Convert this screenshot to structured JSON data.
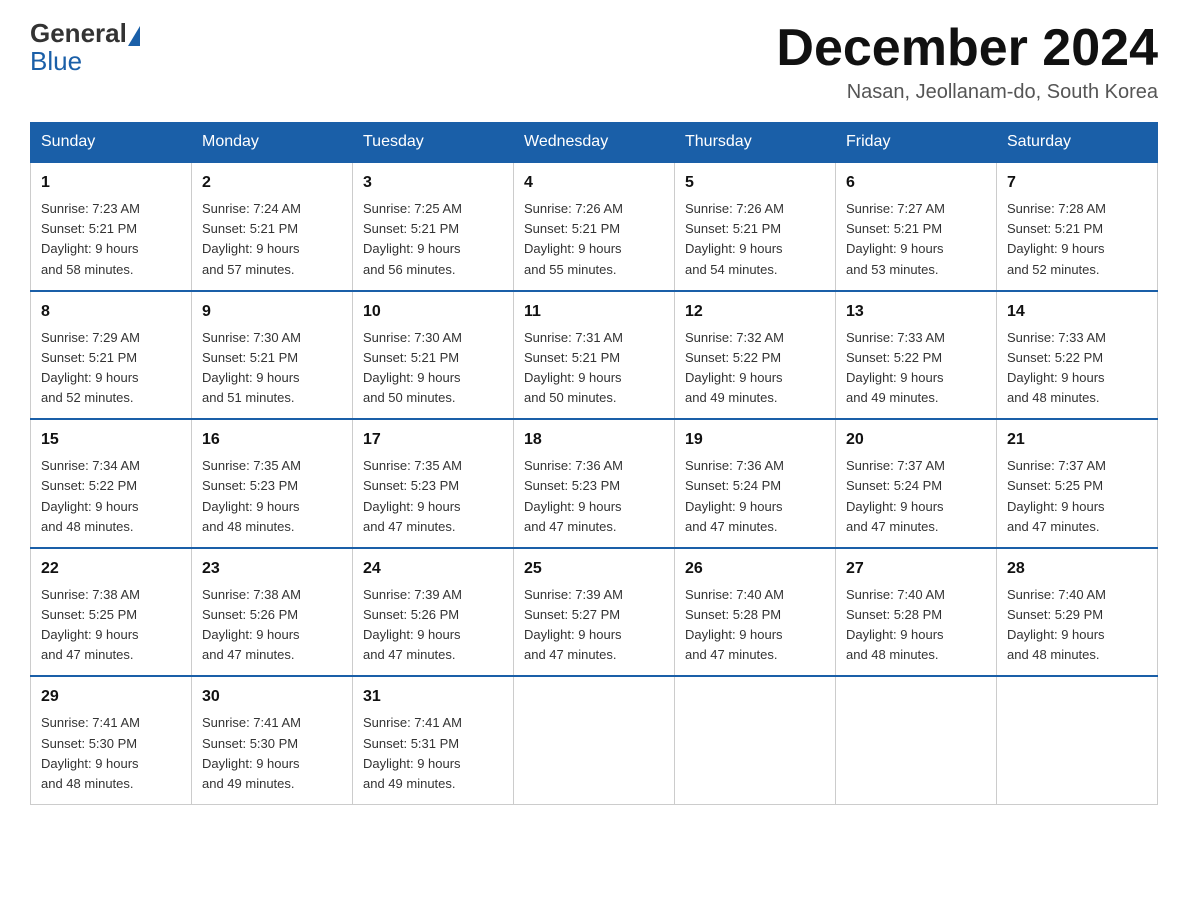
{
  "logo": {
    "text_general": "General",
    "text_blue": "Blue"
  },
  "header": {
    "title": "December 2024",
    "subtitle": "Nasan, Jeollanam-do, South Korea"
  },
  "days_of_week": [
    "Sunday",
    "Monday",
    "Tuesday",
    "Wednesday",
    "Thursday",
    "Friday",
    "Saturday"
  ],
  "weeks": [
    [
      {
        "day": "1",
        "sunrise": "7:23 AM",
        "sunset": "5:21 PM",
        "daylight": "9 hours and 58 minutes."
      },
      {
        "day": "2",
        "sunrise": "7:24 AM",
        "sunset": "5:21 PM",
        "daylight": "9 hours and 57 minutes."
      },
      {
        "day": "3",
        "sunrise": "7:25 AM",
        "sunset": "5:21 PM",
        "daylight": "9 hours and 56 minutes."
      },
      {
        "day": "4",
        "sunrise": "7:26 AM",
        "sunset": "5:21 PM",
        "daylight": "9 hours and 55 minutes."
      },
      {
        "day": "5",
        "sunrise": "7:26 AM",
        "sunset": "5:21 PM",
        "daylight": "9 hours and 54 minutes."
      },
      {
        "day": "6",
        "sunrise": "7:27 AM",
        "sunset": "5:21 PM",
        "daylight": "9 hours and 53 minutes."
      },
      {
        "day": "7",
        "sunrise": "7:28 AM",
        "sunset": "5:21 PM",
        "daylight": "9 hours and 52 minutes."
      }
    ],
    [
      {
        "day": "8",
        "sunrise": "7:29 AM",
        "sunset": "5:21 PM",
        "daylight": "9 hours and 52 minutes."
      },
      {
        "day": "9",
        "sunrise": "7:30 AM",
        "sunset": "5:21 PM",
        "daylight": "9 hours and 51 minutes."
      },
      {
        "day": "10",
        "sunrise": "7:30 AM",
        "sunset": "5:21 PM",
        "daylight": "9 hours and 50 minutes."
      },
      {
        "day": "11",
        "sunrise": "7:31 AM",
        "sunset": "5:21 PM",
        "daylight": "9 hours and 50 minutes."
      },
      {
        "day": "12",
        "sunrise": "7:32 AM",
        "sunset": "5:22 PM",
        "daylight": "9 hours and 49 minutes."
      },
      {
        "day": "13",
        "sunrise": "7:33 AM",
        "sunset": "5:22 PM",
        "daylight": "9 hours and 49 minutes."
      },
      {
        "day": "14",
        "sunrise": "7:33 AM",
        "sunset": "5:22 PM",
        "daylight": "9 hours and 48 minutes."
      }
    ],
    [
      {
        "day": "15",
        "sunrise": "7:34 AM",
        "sunset": "5:22 PM",
        "daylight": "9 hours and 48 minutes."
      },
      {
        "day": "16",
        "sunrise": "7:35 AM",
        "sunset": "5:23 PM",
        "daylight": "9 hours and 48 minutes."
      },
      {
        "day": "17",
        "sunrise": "7:35 AM",
        "sunset": "5:23 PM",
        "daylight": "9 hours and 47 minutes."
      },
      {
        "day": "18",
        "sunrise": "7:36 AM",
        "sunset": "5:23 PM",
        "daylight": "9 hours and 47 minutes."
      },
      {
        "day": "19",
        "sunrise": "7:36 AM",
        "sunset": "5:24 PM",
        "daylight": "9 hours and 47 minutes."
      },
      {
        "day": "20",
        "sunrise": "7:37 AM",
        "sunset": "5:24 PM",
        "daylight": "9 hours and 47 minutes."
      },
      {
        "day": "21",
        "sunrise": "7:37 AM",
        "sunset": "5:25 PM",
        "daylight": "9 hours and 47 minutes."
      }
    ],
    [
      {
        "day": "22",
        "sunrise": "7:38 AM",
        "sunset": "5:25 PM",
        "daylight": "9 hours and 47 minutes."
      },
      {
        "day": "23",
        "sunrise": "7:38 AM",
        "sunset": "5:26 PM",
        "daylight": "9 hours and 47 minutes."
      },
      {
        "day": "24",
        "sunrise": "7:39 AM",
        "sunset": "5:26 PM",
        "daylight": "9 hours and 47 minutes."
      },
      {
        "day": "25",
        "sunrise": "7:39 AM",
        "sunset": "5:27 PM",
        "daylight": "9 hours and 47 minutes."
      },
      {
        "day": "26",
        "sunrise": "7:40 AM",
        "sunset": "5:28 PM",
        "daylight": "9 hours and 47 minutes."
      },
      {
        "day": "27",
        "sunrise": "7:40 AM",
        "sunset": "5:28 PM",
        "daylight": "9 hours and 48 minutes."
      },
      {
        "day": "28",
        "sunrise": "7:40 AM",
        "sunset": "5:29 PM",
        "daylight": "9 hours and 48 minutes."
      }
    ],
    [
      {
        "day": "29",
        "sunrise": "7:41 AM",
        "sunset": "5:30 PM",
        "daylight": "9 hours and 48 minutes."
      },
      {
        "day": "30",
        "sunrise": "7:41 AM",
        "sunset": "5:30 PM",
        "daylight": "9 hours and 49 minutes."
      },
      {
        "day": "31",
        "sunrise": "7:41 AM",
        "sunset": "5:31 PM",
        "daylight": "9 hours and 49 minutes."
      },
      null,
      null,
      null,
      null
    ]
  ],
  "labels": {
    "sunrise": "Sunrise:",
    "sunset": "Sunset:",
    "daylight": "Daylight:"
  }
}
